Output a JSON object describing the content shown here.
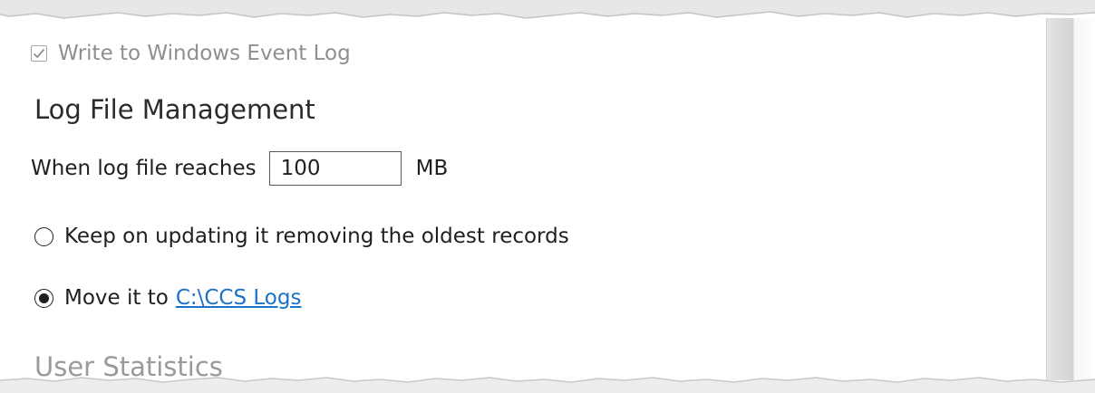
{
  "log_options": {
    "event_log_label": "Write to Windows Event Log",
    "event_log_checked": true
  },
  "log_file_management": {
    "title": "Log File Management",
    "size_label": "When log file reaches",
    "size_value": "100",
    "size_unit": "MB",
    "options": [
      {
        "label": "Keep on updating it removing the oldest records",
        "selected": false
      },
      {
        "label": "Move it to",
        "selected": true,
        "link_text": "C:\\CCS Logs"
      }
    ]
  },
  "next_section": {
    "title": "User Statistics"
  },
  "colors": {
    "link": "#1a73c8",
    "disabled_text": "#8f8f8f",
    "faded_heading": "#9a9a9a"
  },
  "icons": {
    "event_log_checkbox": "checkbox-checked-icon",
    "keep_radio": "radio-empty-icon",
    "move_radio": "radio-selected-icon"
  }
}
